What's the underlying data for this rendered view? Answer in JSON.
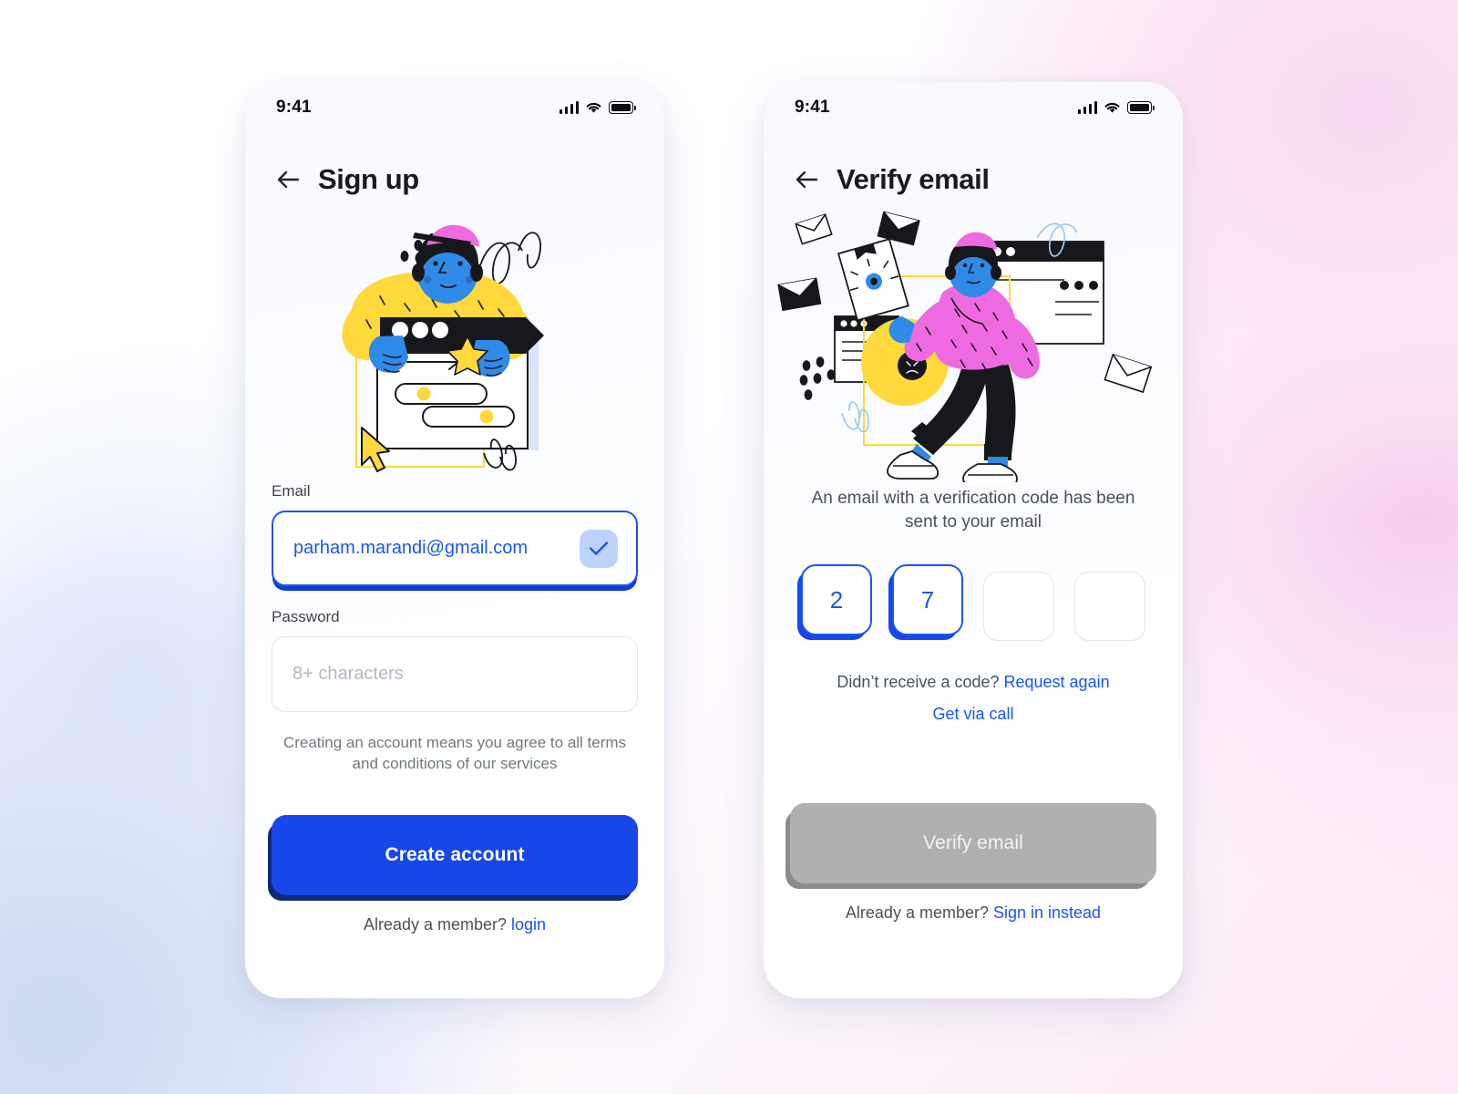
{
  "screens": [
    {
      "status": {
        "time": "9:41"
      },
      "header": {
        "title": "Sign up",
        "back_icon": "arrow-left-icon"
      },
      "illustration": "signup-person-form-illustration",
      "email": {
        "label": "Email",
        "value": "parham.marandi@gmail.com",
        "valid_icon": "check-icon"
      },
      "password": {
        "label": "Password",
        "value": "",
        "placeholder": "8+ characters"
      },
      "terms": "Creating an account means you agree to all terms and conditions of our services",
      "cta": "Create account",
      "footer": {
        "text": "Already a member? ",
        "link": "login"
      }
    },
    {
      "status": {
        "time": "9:41"
      },
      "header": {
        "title": "Verify email",
        "back_icon": "arrow-left-icon"
      },
      "illustration": "verify-person-walking-illustration",
      "message": "An email with a verification code has been sent to your email",
      "otp": [
        "2",
        "7",
        "",
        ""
      ],
      "resend": {
        "text": "Didn’t receive a code? ",
        "link": "Request again"
      },
      "call_link": "Get via call",
      "cta": "Verify email",
      "footer": {
        "text": "Already a member? ",
        "link": "Sign in instead"
      }
    }
  ],
  "colors": {
    "accent_blue": "#1a56ef",
    "button_blue": "#1747e8",
    "button_shadow": "#0e2a78",
    "disabled_gray": "#b0b0b0",
    "disabled_shadow": "#8c8c8c",
    "illus_yellow": "#ffd93b",
    "illus_pink": "#ee6ae0",
    "illus_blue": "#2f8ae8",
    "text_dark": "#1b1b1f",
    "text_muted": "#74797f"
  }
}
